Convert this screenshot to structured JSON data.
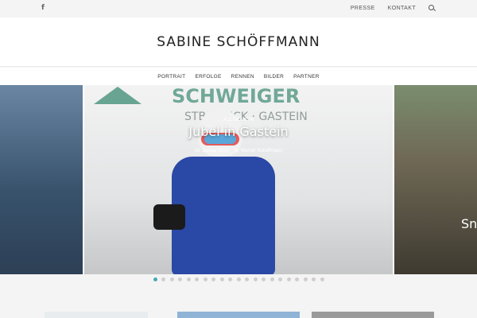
{
  "topbar": {
    "facebook_icon": "f",
    "links": [
      {
        "label": "PRESSE"
      },
      {
        "label": "KONTAKT"
      }
    ],
    "search_icon": "search-icon"
  },
  "header": {
    "site_title": "SABINE SCHÖFFMANN"
  },
  "nav": {
    "items": [
      {
        "label": "PORTRAIT"
      },
      {
        "label": "ERFOLGE"
      },
      {
        "label": "RENNEN"
      },
      {
        "label": "BILDER"
      },
      {
        "label": "PARTNER"
      }
    ]
  },
  "slider": {
    "current": {
      "category": "ALLGEMEIN",
      "title": "Jubel in Gastein",
      "date": "18. Januar 2024",
      "author": "by Werner Schöffmann",
      "banner_text": "SCHWEIGER",
      "banner_sub": "STB BRUCK · GASTEIN"
    },
    "next_partial_title": "Sn",
    "dots_total": 21,
    "dots_active_index": 0,
    "accent_color": "#4aa9b8"
  }
}
